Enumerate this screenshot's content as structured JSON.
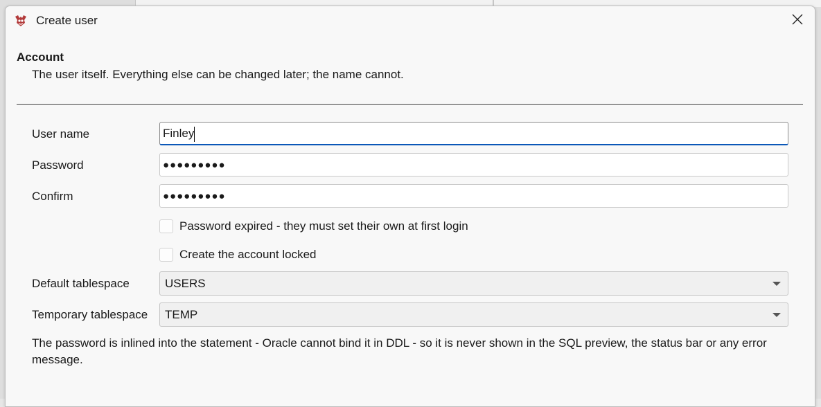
{
  "dialog": {
    "title": "Create user",
    "section_title": "Account",
    "section_description": "The user itself. Everything else can be changed later; the name cannot."
  },
  "form": {
    "username_label": "User name",
    "username_value": "Finley",
    "password_label": "Password",
    "password_mask": "●●●●●●●●●",
    "confirm_label": "Confirm",
    "confirm_mask": "●●●●●●●●●",
    "password_expired_label": "Password expired - they must set their own at first login",
    "password_expired_checked": false,
    "account_locked_label": "Create the account locked",
    "account_locked_checked": false,
    "default_tablespace_label": "Default tablespace",
    "default_tablespace_value": "USERS",
    "temporary_tablespace_label": "Temporary tablespace",
    "temporary_tablespace_value": "TEMP"
  },
  "footnote": "The password is inlined into the statement - Oracle cannot bind it in DDL - so it is never shown in the SQL preview, the status bar or any error message.",
  "colors": {
    "focus_accent": "#0b57b8",
    "dialog_background": "#f8f8f8",
    "app_icon_red": "#b23a3a"
  }
}
